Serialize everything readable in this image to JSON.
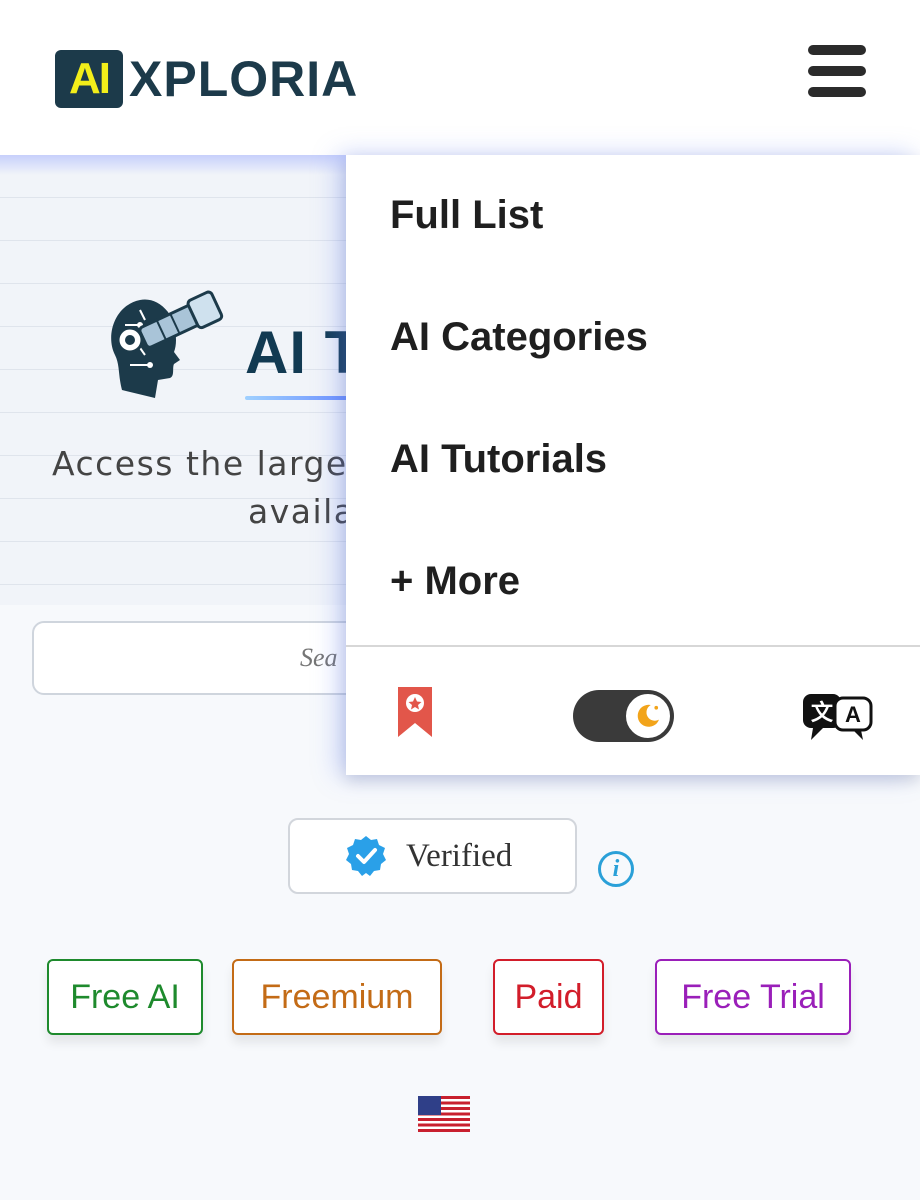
{
  "header": {
    "logo_badge": "AI",
    "logo_text": "XPLORIA",
    "menu_icon": "hamburger-menu-icon"
  },
  "hero": {
    "brand_title": "AI T",
    "tagline_line1": "Access the large",
    "tagline_line2": "availa"
  },
  "search": {
    "placeholder": "Sea"
  },
  "verified": {
    "label": "Verified",
    "icon": "verified-badge-icon",
    "info_icon": "info-icon",
    "info_glyph": "i"
  },
  "filters": [
    {
      "label": "Free AI",
      "color": "#1e8a2d"
    },
    {
      "label": "Freemium",
      "color": "#c36b16"
    },
    {
      "label": "Paid",
      "color": "#d21d2a"
    },
    {
      "label": "Free Trial",
      "color": "#9a1fb9"
    }
  ],
  "language_flag": "us-flag-icon",
  "menu": {
    "items": [
      "Full List",
      "AI Categories",
      "AI Tutorials",
      "+ More"
    ],
    "bookmark_icon": "bookmark-icon",
    "theme_toggle": "dark-mode-toggle",
    "translate_icon": "translate-icon"
  },
  "colors": {
    "brand_dark": "#1c3a4a",
    "brand_yellow": "#f3ee1a",
    "bookmark_red": "#e2564a",
    "moon_orange": "#f2a41a",
    "info_blue": "#2aa0d8"
  }
}
